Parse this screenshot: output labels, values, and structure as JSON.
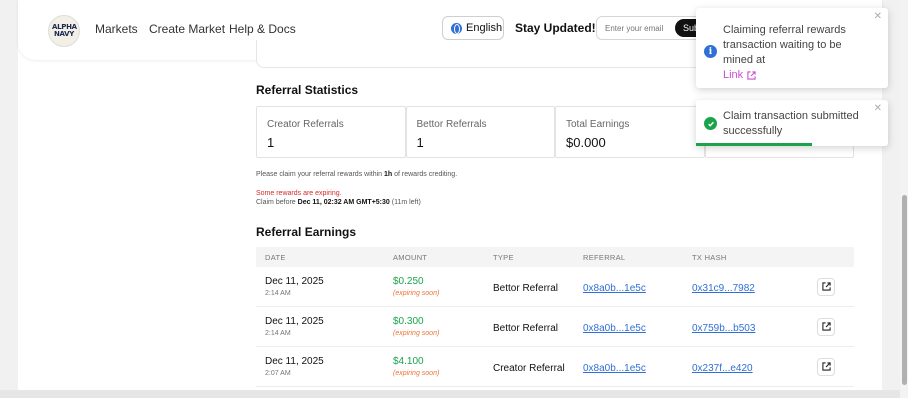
{
  "header": {
    "logo_text": "ALPHA NAVY",
    "nav": [
      "Markets",
      "Create Market",
      "Help & Docs"
    ],
    "language": "English",
    "stay_updated": "Stay Updated!",
    "email_placeholder": "Enter your email",
    "subscribe_label": "Sub"
  },
  "stats": {
    "title": "Referral Statistics",
    "items": [
      {
        "label": "Creator Referrals",
        "value": "1"
      },
      {
        "label": "Bettor Referrals",
        "value": "1"
      },
      {
        "label": "Total Earnings",
        "value": "$0.000"
      }
    ]
  },
  "notes": {
    "claim_prefix": "Please claim your referral rewards within ",
    "claim_bold": "1h",
    "claim_suffix": " of rewards crediting.",
    "expiring": "Some rewards are expiring.",
    "claim_before_prefix": "Claim before ",
    "claim_before_bold": "Dec 11, 02:32 AM GMT+5:30",
    "claim_before_suffix": " (11m left)"
  },
  "earnings": {
    "title": "Referral Earnings",
    "headers": [
      "DATE",
      "AMOUNT",
      "TYPE",
      "REFERRAL",
      "TX HASH"
    ],
    "rows": [
      {
        "date": "Dec 11, 2025",
        "time": "2:14 AM",
        "amount": "$0.250",
        "amount_note": "(expiring soon)",
        "type": "Bettor Referral",
        "referral": "0x8a0b...1e5c",
        "tx": "0x31c9...7982"
      },
      {
        "date": "Dec 11, 2025",
        "time": "2:14 AM",
        "amount": "$0.300",
        "amount_note": "(expiring soon)",
        "type": "Bettor Referral",
        "referral": "0x8a0b...1e5c",
        "tx": "0x759b...b503"
      },
      {
        "date": "Dec 11, 2025",
        "time": "2:07 AM",
        "amount": "$4.100",
        "amount_note": "(expiring soon)",
        "type": "Creator Referral",
        "referral": "0x8a0b...1e5c",
        "tx": "0x237f...e420"
      }
    ]
  },
  "toasts": [
    {
      "message": "Claiming referral rewards transaction waiting to be mined at",
      "link": "Link",
      "kind": "info"
    },
    {
      "message": "Claim transaction submitted successfully",
      "kind": "success"
    }
  ],
  "colors": {
    "accent": "#2f6fd6",
    "success": "#1aa34a",
    "warning": "#e8743b",
    "danger": "#d32b2b",
    "toast_link": "#c94ed0"
  }
}
